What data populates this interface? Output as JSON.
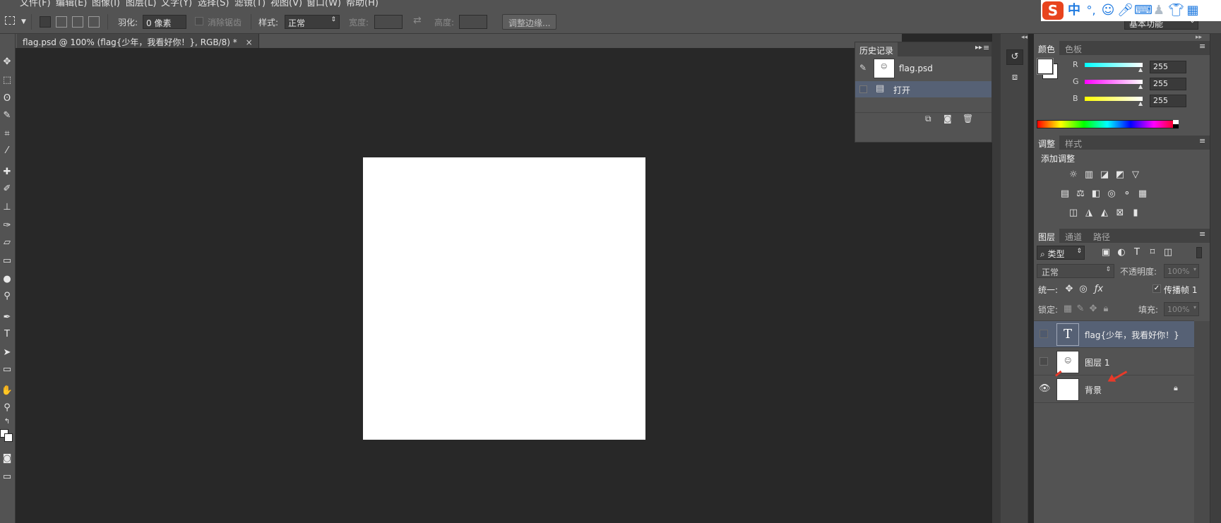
{
  "menu": [
    "文件(F)",
    "编辑(E)",
    "图像(I)",
    "图层(L)",
    "文字(Y)",
    "选择(S)",
    "滤镜(T)",
    "视图(V)",
    "窗口(W)",
    "帮助(H)"
  ],
  "options": {
    "feather_label": "羽化:",
    "feather_value": "0 像素",
    "antialias_label": "消除锯齿",
    "style_label": "样式:",
    "style_value": "正常",
    "width_label": "宽度:",
    "height_label": "高度:",
    "refine_button": "调整边缘..."
  },
  "workspace": "基本功能",
  "document": {
    "tab_title": "flag.psd @ 100% (flag{少年，我看好你！}, RGB/8) *",
    "close": "×"
  },
  "history": {
    "tab": "历史记录",
    "snapshot_name": "flag.psd",
    "step": "打开"
  },
  "color_panel": {
    "tab_color": "颜色",
    "tab_swatches": "色板",
    "r_label": "R",
    "g_label": "G",
    "b_label": "B",
    "r_value": "255",
    "g_value": "255",
    "b_value": "255"
  },
  "adjust_panel": {
    "tab_adjust": "调整",
    "tab_styles": "样式",
    "title": "添加调整"
  },
  "layers_panel": {
    "tab_layers": "图层",
    "tab_channels": "通道",
    "tab_paths": "路径",
    "filter_kind": "类型",
    "blend_mode": "正常",
    "opacity_label": "不透明度:",
    "opacity_value": "100%",
    "unify_label": "统一:",
    "propagate_label": "传播帧 1",
    "lock_label": "锁定:",
    "fill_label": "填充:",
    "fill_value": "100%",
    "layers": [
      {
        "name": "flag{少年，我看好你！}",
        "type": "text"
      },
      {
        "name": "图层 1",
        "type": "image"
      },
      {
        "name": "背景",
        "type": "background"
      }
    ]
  },
  "ime": {
    "logo": "S",
    "mode": "中",
    "punct": "°,"
  },
  "colors": {
    "panel_bg": "#535353",
    "canvas_bg": "#282828",
    "active_layer": "#566175",
    "annotation_arrow": "#e83a2a"
  }
}
